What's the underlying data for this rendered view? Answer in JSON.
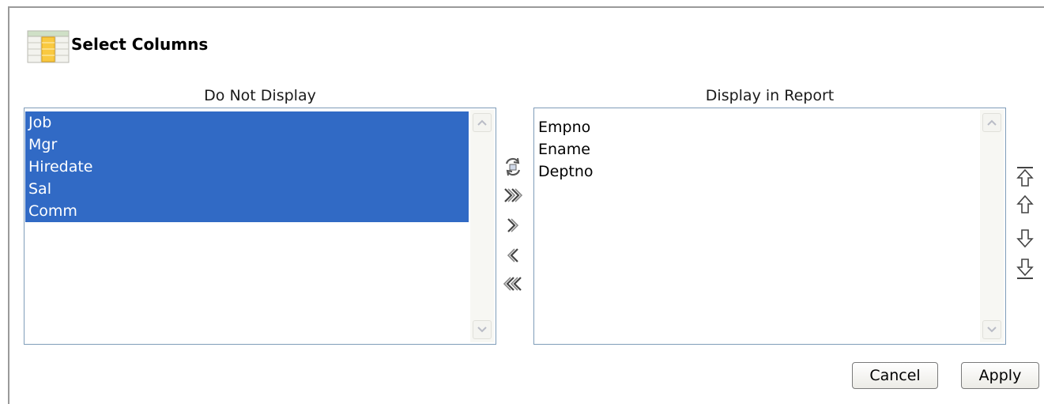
{
  "dialog": {
    "title": "Select Columns",
    "title_icon": "table-columns-icon"
  },
  "left_list": {
    "label": "Do Not Display",
    "items": [
      {
        "label": "Job",
        "selected": true
      },
      {
        "label": "Mgr",
        "selected": true
      },
      {
        "label": "Hiredate",
        "selected": true
      },
      {
        "label": "Sal",
        "selected": true
      },
      {
        "label": "Comm",
        "selected": true
      }
    ]
  },
  "right_list": {
    "label": "Display in Report",
    "items": [
      {
        "label": "Empno",
        "selected": false
      },
      {
        "label": "Ename",
        "selected": false
      },
      {
        "label": "Deptno",
        "selected": false
      }
    ]
  },
  "transfer_controls": [
    {
      "name": "reset-icon",
      "action": "reset"
    },
    {
      "name": "move-all-right-icon",
      "action": "move all to display"
    },
    {
      "name": "move-right-icon",
      "action": "move selected to display"
    },
    {
      "name": "move-left-icon",
      "action": "move selected to do not display"
    },
    {
      "name": "move-all-left-icon",
      "action": "move all to do not display"
    }
  ],
  "order_controls": [
    {
      "name": "move-top-icon",
      "action": "move to top"
    },
    {
      "name": "move-up-icon",
      "action": "move up"
    },
    {
      "name": "move-down-icon",
      "action": "move down"
    },
    {
      "name": "move-bottom-icon",
      "action": "move to bottom"
    }
  ],
  "buttons": {
    "cancel_label": "Cancel",
    "apply_label": "Apply"
  },
  "colors": {
    "selection": "#316ac5",
    "listbox_border": "#7f9db9",
    "panel_border": "#9a9a9a"
  }
}
